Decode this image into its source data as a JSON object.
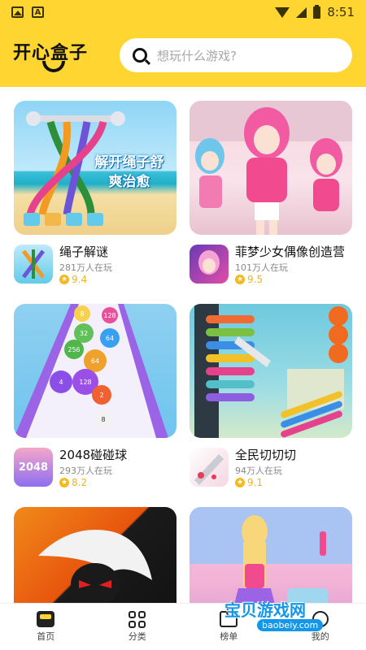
{
  "status_bar": {
    "time": "8:51"
  },
  "header": {
    "logo_text": "开心盒子",
    "search_placeholder": "想玩什么游戏?"
  },
  "games": [
    {
      "title": "绳子解谜",
      "players": "281万人在玩",
      "rating": "9.4",
      "banner_text": "解开绳子舒爽治愈"
    },
    {
      "title": "菲梦少女偶像创造营",
      "players": "101万人在玩",
      "rating": "9.5"
    },
    {
      "title": "2048碰碰球",
      "players": "293万人在玩",
      "rating": "8.2",
      "icon_text": "2048"
    },
    {
      "title": "全民切切切",
      "players": "94万人在玩",
      "rating": "9.1"
    },
    {
      "title": "",
      "players": "",
      "rating": ""
    },
    {
      "title": "",
      "players": "",
      "rating": ""
    }
  ],
  "ball_labels": [
    "8",
    "128",
    "32",
    "64",
    "256",
    "64",
    "128",
    "4",
    "2",
    "8"
  ],
  "bottom_nav": [
    {
      "label": "首页"
    },
    {
      "label": "分类"
    },
    {
      "label": "榜单"
    },
    {
      "label": "我的"
    }
  ],
  "watermark": {
    "text": "宝贝游戏网",
    "url": "baobeiy.com"
  },
  "colors": {
    "brand_yellow": "#ffd531",
    "rating_star": "#f6b91a",
    "watermark_blue": "#1497e8"
  }
}
